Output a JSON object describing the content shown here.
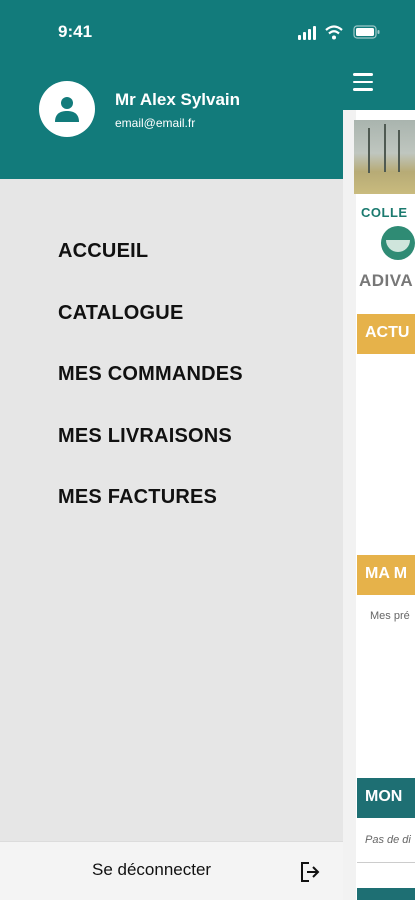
{
  "status_bar": {
    "time": "9:41"
  },
  "user": {
    "name": "Mr Alex Sylvain",
    "email": "email@email.fr"
  },
  "menu": {
    "items": [
      {
        "label": "ACCUEIL"
      },
      {
        "label": "CATALOGUE"
      },
      {
        "label": "MES COMMANDES"
      },
      {
        "label": "MES LIVRAISONS"
      },
      {
        "label": "MES FACTURES"
      }
    ]
  },
  "logout": {
    "label": "Se déconnecter"
  },
  "background_screen": {
    "collection_text": "COLLE",
    "brand_text": "ADIVA",
    "banner_1": "ACTU",
    "banner_2": "MA M",
    "banner_2_sub": "Mes pré",
    "banner_3": "MON",
    "banner_3_sub": "Pas de di"
  },
  "colors": {
    "header_teal": "#127b7b",
    "drawer_bg": "#e6e6e6",
    "banner_yellow": "#e6b24a",
    "banner_teal": "#1e6f73"
  }
}
